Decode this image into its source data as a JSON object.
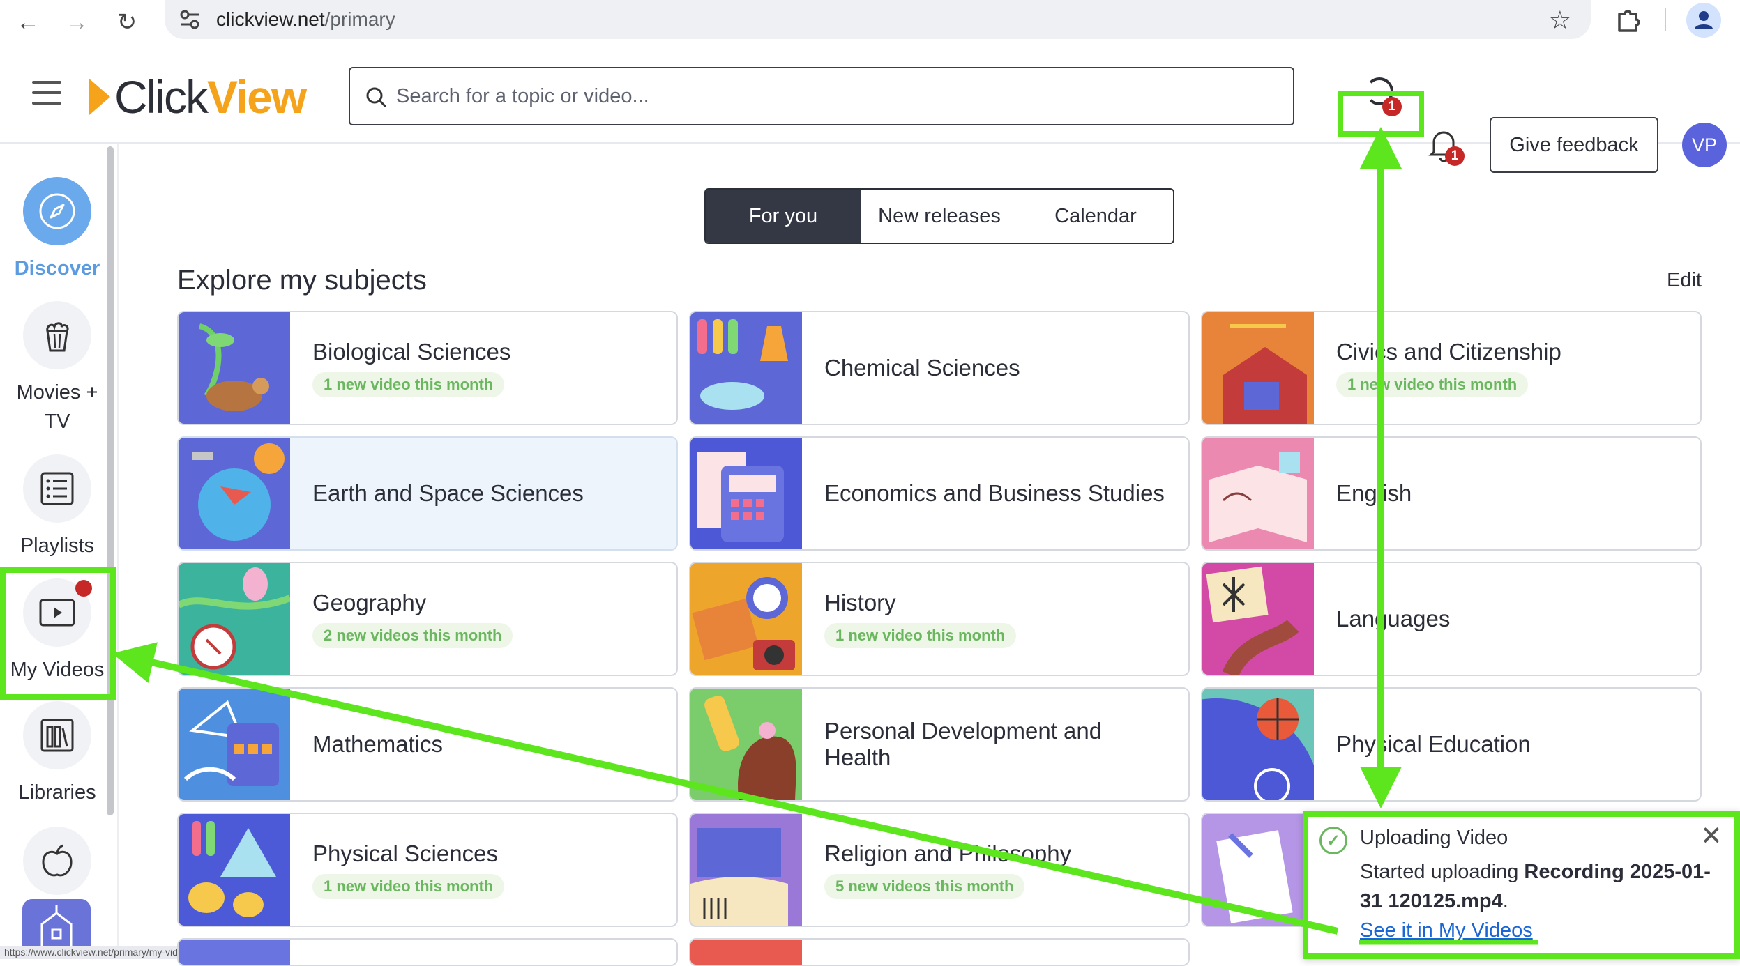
{
  "browser": {
    "url_domain": "clickview.net",
    "url_path": "/primary",
    "back_icon": "arrow-left",
    "forward_icon": "arrow-right",
    "reload_icon": "reload",
    "status_url": "https://www.clickview.net/primary/my-videos/83e5124-video-upload-processing"
  },
  "header": {
    "brand_part1": "Click",
    "brand_part2": "View",
    "search_placeholder": "Search for a topic or video...",
    "upload_badge": "1",
    "notifications_badge": "1",
    "feedback_label": "Give feedback",
    "avatar_initials": "VP"
  },
  "sidebar": {
    "items": [
      {
        "label": "Discover",
        "icon": "compass-icon",
        "active": true
      },
      {
        "label": "Movies + TV",
        "icon": "popcorn-icon"
      },
      {
        "label": "Playlists",
        "icon": "list-icon"
      },
      {
        "label": "My Videos",
        "icon": "play-icon",
        "has_notification": true
      },
      {
        "label": "Libraries",
        "icon": "library-icon"
      },
      {
        "label": "",
        "icon": "apple-icon"
      },
      {
        "label": "",
        "icon": "school-icon"
      }
    ]
  },
  "tabs": [
    "For you",
    "New releases",
    "Calendar"
  ],
  "section": {
    "title": "Explore my subjects",
    "edit_label": "Edit"
  },
  "subjects": [
    {
      "name": "Biological Sciences",
      "badge": "1 new video this month",
      "thumb_color": "#5d67d6"
    },
    {
      "name": "Chemical Sciences",
      "badge": "",
      "thumb_color": "#5d67d6"
    },
    {
      "name": "Civics and Citizenship",
      "badge": "1 new video this month",
      "thumb_color": "#e8833a"
    },
    {
      "name": "Earth and Space Sciences",
      "badge": "",
      "thumb_color": "#5d67d6"
    },
    {
      "name": "Economics and Business Studies",
      "badge": "",
      "thumb_color": "#4c58d6"
    },
    {
      "name": "English",
      "badge": "",
      "thumb_color": "#ec89b1"
    },
    {
      "name": "Geography",
      "badge": "2 new videos this month",
      "thumb_color": "#3bb39d"
    },
    {
      "name": "History",
      "badge": "1 new video this month",
      "thumb_color": "#eda52c"
    },
    {
      "name": "Languages",
      "badge": "",
      "thumb_color": "#d24aa6"
    },
    {
      "name": "Mathematics",
      "badge": "",
      "thumb_color": "#4e8fe0"
    },
    {
      "name": "Personal Development and Health",
      "badge": "",
      "thumb_color": "#7acd6a"
    },
    {
      "name": "Physical Education",
      "badge": "",
      "thumb_color": "#6bc5b8"
    },
    {
      "name": "Physical Sciences",
      "badge": "1 new video this month",
      "thumb_color": "#4d5ad8"
    },
    {
      "name": "Religion and Philosophy",
      "badge": "5 new videos this month",
      "thumb_color": "#9a78d8"
    },
    {
      "name": "",
      "badge": "",
      "thumb_color": "#b596e6"
    }
  ],
  "toast": {
    "title": "Uploading Video",
    "body_prefix": "Started uploading ",
    "filename": "Recording 2025-01-31 120125.mp4",
    "body_suffix": ".",
    "link_label": "See it in My Videos"
  },
  "annotation_color": "#5de51d"
}
